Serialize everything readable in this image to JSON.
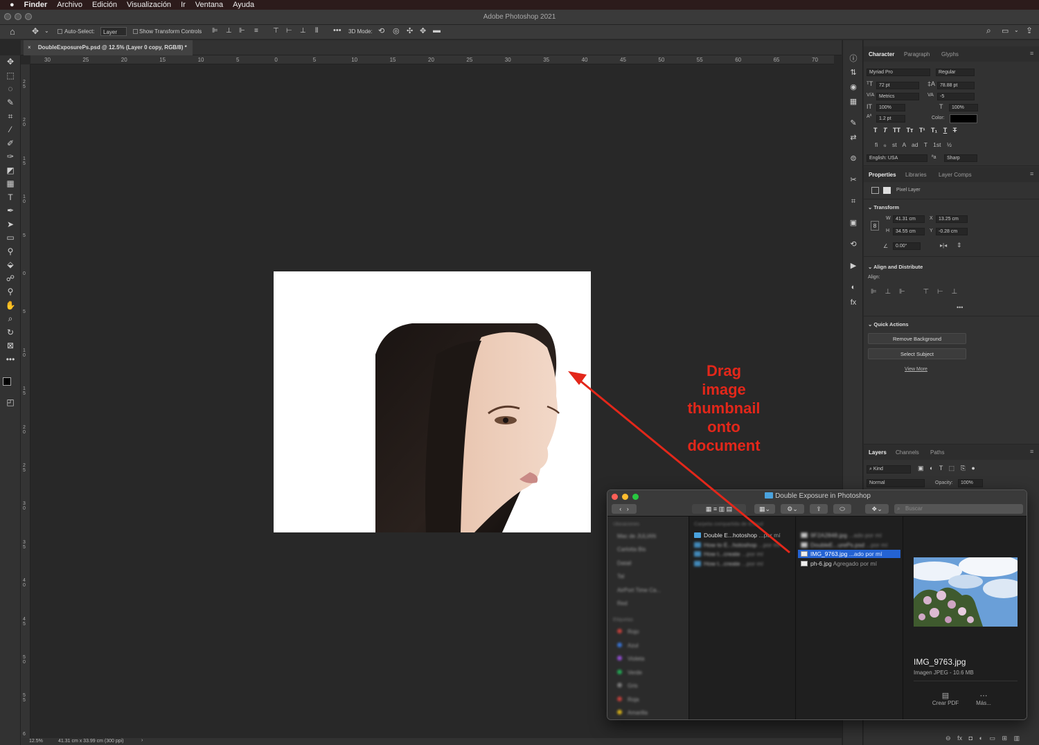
{
  "menubar": {
    "apple": "",
    "app": "Finder",
    "items": [
      "Archivo",
      "Edición",
      "Visualización",
      "Ir",
      "Ventana",
      "Ayuda"
    ]
  },
  "window": {
    "title": "Adobe Photoshop 2021"
  },
  "options": {
    "auto_select_label": "Auto-Select:",
    "auto_select_value": "Layer",
    "show_transform": "Show Transform Controls",
    "three_d_mode": "3D Mode:"
  },
  "document": {
    "tab_title": "DoubleExposurePs.psd @ 12.5% (Layer 0 copy, RGB/8) *"
  },
  "ruler_top": [
    "30",
    "25",
    "20",
    "15",
    "10",
    "5",
    "0",
    "5",
    "10",
    "15",
    "20",
    "25",
    "30",
    "35",
    "40",
    "45",
    "50",
    "55",
    "60",
    "65",
    "70"
  ],
  "ruler_left": [
    "2 5",
    "2 0",
    "1 5",
    "1 0",
    "5",
    "0",
    "5",
    "1 0",
    "1 5",
    "2 0",
    "2 5",
    "3 0",
    "3 5",
    "4 0",
    "4 5",
    "5 0",
    "5 5",
    "6"
  ],
  "status": {
    "zoom": "12.5%",
    "size": "41.31 cm x 33.99 cm (300 ppi)",
    "arrow": "›"
  },
  "character_panel": {
    "tabs": [
      "Character",
      "Paragraph",
      "Glyphs"
    ],
    "font_family": "Myriad Pro",
    "font_style": "Regular",
    "size": "72 pt",
    "leading": "78.88 pt",
    "kerning": "Metrics",
    "tracking": "-5",
    "vscale": "100%",
    "hscale": "100%",
    "baseline": "1.2 pt",
    "color_label": "Color:",
    "text_color": "#000000",
    "style_buttons": [
      "T",
      "T",
      "TT",
      "Tт",
      "T¹",
      "T₁",
      "T",
      "T"
    ],
    "ot_buttons": [
      "fi",
      "ℴ",
      "st",
      "A",
      "ad",
      "T",
      "1st",
      "½"
    ],
    "language": "English: USA",
    "aa_label": "ªa",
    "antialias": "Sharp"
  },
  "properties_panel": {
    "tabs": [
      "Properties",
      "Libraries",
      "Layer Comps"
    ],
    "layer_type": "Pixel Layer",
    "transform_title": "Transform",
    "w_label": "W",
    "w": "41.31 cm",
    "x_label": "X",
    "x": "13.25 cm",
    "h_label": "H",
    "h": "34.55 cm",
    "y_label": "Y",
    "y": "-0.28 cm",
    "angle": "0.00°",
    "align_title": "Align and Distribute",
    "align_label": "Align:",
    "quick_title": "Quick Actions",
    "remove_bg": "Remove Background",
    "select_subject": "Select Subject",
    "view_more": "View More"
  },
  "layers_panel": {
    "tabs": [
      "Layers",
      "Channels",
      "Paths"
    ],
    "kind": "Kind",
    "blend": "Normal",
    "opacity_label": "Opacity:",
    "opacity": "100%"
  },
  "finder": {
    "title": "Double Exposure in Photoshop",
    "search_placeholder": "Buscar",
    "sidebar_header1": "Ubicaciones",
    "sidebar_items": [
      "Mac de JULIAN",
      "Carlotta Bis",
      "Datail",
      "Tal",
      "AirPort Time Ca...",
      "Red"
    ],
    "sidebar_header2": "Etiquetas",
    "tags": [
      {
        "name": "Rojo",
        "color": "#e0443e"
      },
      {
        "name": "Azul",
        "color": "#3b82f6"
      },
      {
        "name": "Violeta",
        "color": "#a855f7"
      },
      {
        "name": "Verde",
        "color": "#22c55e"
      },
      {
        "name": "Gris",
        "color": "#8b8b8b"
      },
      {
        "name": "Roja",
        "color": "#e0443e"
      },
      {
        "name": "Amarilla",
        "color": "#facc15"
      }
    ],
    "col1_header": "Carpeta compartida de iCloud",
    "col1_items": [
      {
        "name": "Double E...hotoshop",
        "meta": "...por mí"
      },
      {
        "name": "How to E...hotoshop",
        "meta": "...por mí"
      },
      {
        "name": "How t...create",
        "meta": "...por mí"
      },
      {
        "name": "How t...create",
        "meta": "...por mí"
      }
    ],
    "col2_items": [
      {
        "name": "9F2A2848.jpg",
        "meta": "...ado por mí"
      },
      {
        "name": "DoubleE...urePs.psd",
        "meta": "...por mí"
      },
      {
        "name": "IMG_9763.jpg",
        "meta": "...ado por mí"
      },
      {
        "name": "ph-6.jpg",
        "meta": "Agregado por mí"
      }
    ],
    "preview_name": "IMG_9763.jpg",
    "preview_info": "Imagen JPEG - 10.6 MB",
    "action1": "Crear PDF",
    "action2": "Más..."
  },
  "annotation": {
    "lines": [
      "Drag",
      "image",
      "thumbnail",
      "onto",
      "document"
    ],
    "color": "#e3271a"
  }
}
